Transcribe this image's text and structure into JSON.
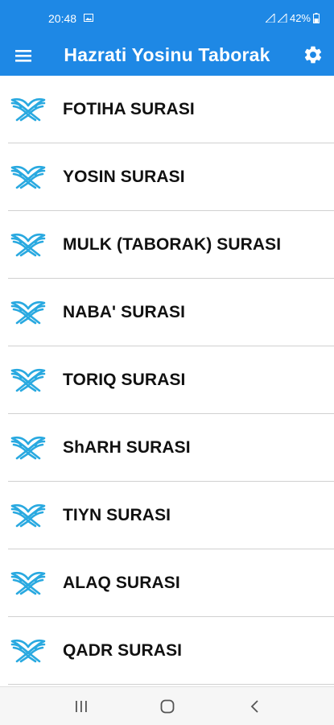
{
  "status_bar": {
    "time": "20:48",
    "battery": "42%"
  },
  "app_bar": {
    "title": "Hazrati Yosinu Taborak",
    "menu_icon": "hamburger-menu-icon",
    "settings_icon": "gear-icon"
  },
  "list": {
    "item_icon": "quran-book-icon",
    "items": [
      {
        "label": "FOTIHA SURASI"
      },
      {
        "label": "YOSIN SURASI"
      },
      {
        "label": "MULK (TABORAK) SURASI"
      },
      {
        "label": "NABA' SURASI"
      },
      {
        "label": "TORIQ SURASI"
      },
      {
        "label": "ShARH SURASI"
      },
      {
        "label": "TIYN SURASI"
      },
      {
        "label": "ALAQ SURASI"
      },
      {
        "label": "QADR SURASI"
      }
    ]
  },
  "nav_bar": {
    "recents_icon": "recent-apps-icon",
    "home_icon": "home-icon",
    "back_icon": "back-icon"
  },
  "colors": {
    "primary": "#1e88e5",
    "icon_blue": "#29a9e0",
    "text": "#111111",
    "divider": "#d0d0d0"
  }
}
